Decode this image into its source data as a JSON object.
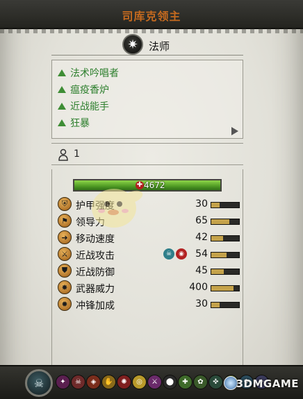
{
  "unit": {
    "name": "司库克领主",
    "class_name": "法师",
    "class_icon": "star-burst-icon",
    "count": "1"
  },
  "abilities": [
    {
      "label": "法术吟唱者"
    },
    {
      "label": "瘟疫香炉"
    },
    {
      "label": "近战能手"
    },
    {
      "label": "狂暴"
    }
  ],
  "health": {
    "value": "4672",
    "fraction": 1.0
  },
  "stats": [
    {
      "label": "护甲强度",
      "value": "30",
      "icon": "armor-icon",
      "bar": 0.3
    },
    {
      "label": "领导力",
      "value": "65",
      "icon": "leadership-icon",
      "bar": 0.65
    },
    {
      "label": "移动速度",
      "value": "42",
      "icon": "speed-icon",
      "bar": 0.42
    },
    {
      "label": "近战攻击",
      "value": "54",
      "icon": "melee-attack-icon",
      "bar": 0.54
    },
    {
      "label": "近战防御",
      "value": "45",
      "icon": "melee-defence-icon",
      "bar": 0.45
    },
    {
      "label": "武器威力",
      "value": "400",
      "icon": "weapon-strength-icon",
      "bar": 0.8
    },
    {
      "label": "冲锋加成",
      "value": "30",
      "icon": "charge-bonus-icon",
      "bar": 0.3
    }
  ],
  "watermark": {
    "text": "3DMGAME"
  },
  "colors": {
    "title": "#c56a1f",
    "ability_green": "#2d7f2d",
    "health_green": "#6fbf34",
    "stat_bar": "#c4a24a"
  }
}
